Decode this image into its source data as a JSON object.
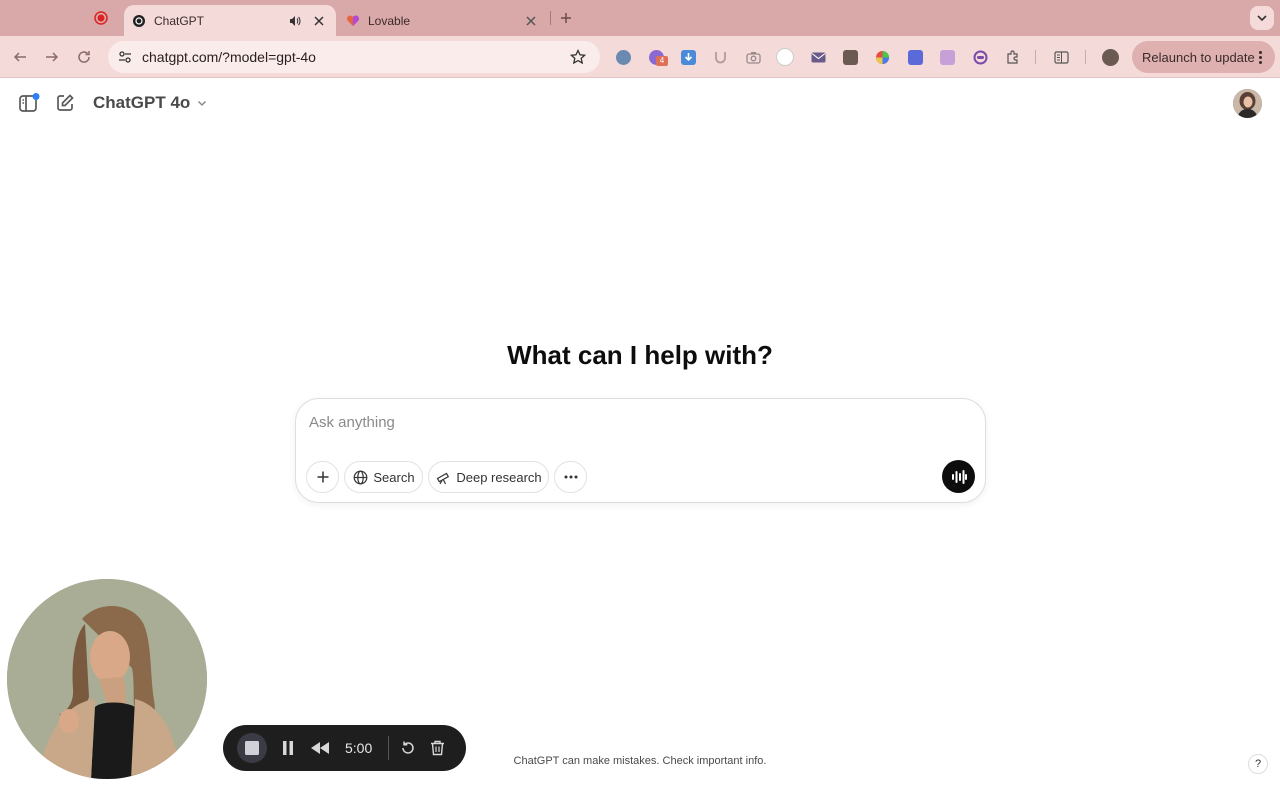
{
  "browser": {
    "tabs": [
      {
        "title": "ChatGPT",
        "active": true,
        "icon": "openai-icon",
        "audio": true
      },
      {
        "title": "Lovable",
        "active": false,
        "icon": "heart-icon"
      }
    ],
    "url": "chatgpt.com/?model=gpt-4o",
    "relaunch_label": "Relaunch to update",
    "extensions": [
      "password-icon",
      "puzzle-badge-icon",
      "download-icon",
      "u-icon",
      "camera-icon",
      "gb-icon",
      "mail-icon",
      "doc-icon",
      "color-wheel-icon",
      "translate-icon",
      "image-icon",
      "lens-icon",
      "extensions-icon"
    ],
    "extension_badge": "4",
    "colors": {
      "tabbar": "#d9a8a8",
      "toolbar": "#f5dada"
    }
  },
  "app": {
    "model_label": "ChatGPT 4o",
    "headline": "What can I help with?",
    "composer": {
      "placeholder": "Ask anything",
      "search_label": "Search",
      "deep_research_label": "Deep research"
    },
    "disclaimer": "ChatGPT can make mistakes. Check important info.",
    "help_label": "?"
  },
  "recorder": {
    "timer": "5:00"
  }
}
